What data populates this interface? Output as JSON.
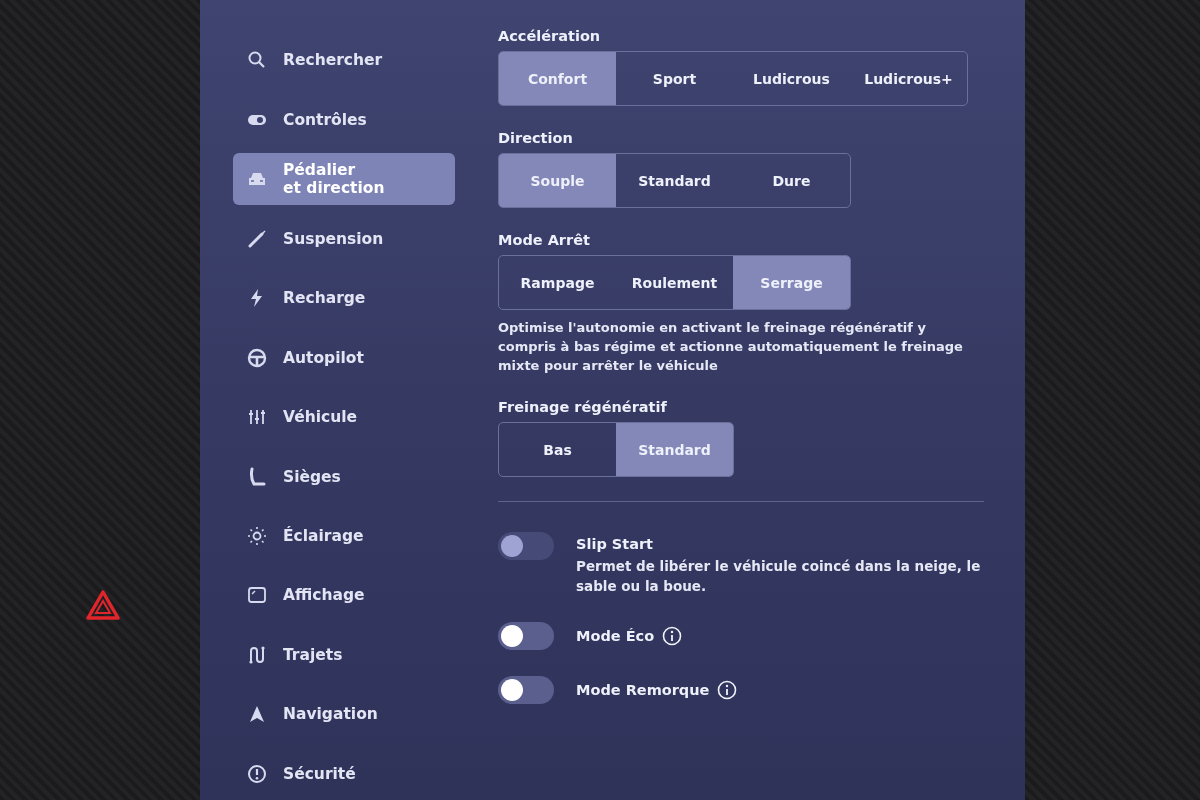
{
  "sidebar": {
    "items": [
      {
        "label": "Rechercher",
        "selected": false
      },
      {
        "label": "Contrôles",
        "selected": false
      },
      {
        "label": "Pédalier\net direction",
        "selected": true
      },
      {
        "label": "Suspension",
        "selected": false
      },
      {
        "label": "Recharge",
        "selected": false
      },
      {
        "label": "Autopilot",
        "selected": false
      },
      {
        "label": "Véhicule",
        "selected": false
      },
      {
        "label": "Sièges",
        "selected": false
      },
      {
        "label": "Éclairage",
        "selected": false
      },
      {
        "label": "Affichage",
        "selected": false
      },
      {
        "label": "Trajets",
        "selected": false
      },
      {
        "label": "Navigation",
        "selected": false
      },
      {
        "label": "Sécurité",
        "selected": false
      }
    ]
  },
  "sections": [
    {
      "title": "Accélération",
      "options": [
        {
          "label": "Confort",
          "selected": true
        },
        {
          "label": "Sport",
          "selected": false
        },
        {
          "label": "Ludicrous",
          "selected": false
        },
        {
          "label": "Ludicrous+",
          "selected": false
        }
      ]
    },
    {
      "title": "Direction",
      "options": [
        {
          "label": "Souple",
          "selected": true
        },
        {
          "label": "Standard",
          "selected": false
        },
        {
          "label": "Dure",
          "selected": false
        }
      ]
    },
    {
      "title": "Mode Arrêt",
      "options": [
        {
          "label": "Rampage",
          "selected": false
        },
        {
          "label": "Roulement",
          "selected": false
        },
        {
          "label": "Serrage",
          "selected": true
        }
      ],
      "description": "Optimise l'autonomie en activant le freinage régénératif y compris à bas régime et actionne automatiquement le freinage mixte pour arrêter le véhicule"
    },
    {
      "title": "Freinage régénératif",
      "options": [
        {
          "label": "Bas",
          "selected": false
        },
        {
          "label": "Standard",
          "selected": true
        }
      ]
    }
  ],
  "toggles": [
    {
      "label": "Slip Start",
      "on": false,
      "disabled": true,
      "info": false,
      "description": "Permet de libérer le véhicule coincé dans la neige, le sable ou la boue."
    },
    {
      "label": "Mode Éco",
      "on": false,
      "disabled": false,
      "info": true
    },
    {
      "label": "Mode Remorque",
      "on": false,
      "disabled": false,
      "info": true
    }
  ]
}
